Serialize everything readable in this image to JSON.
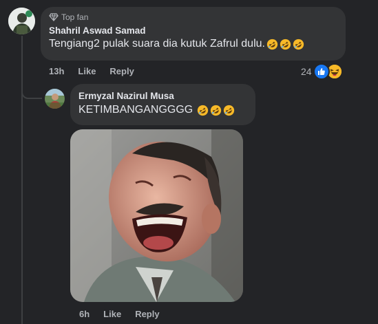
{
  "comment": {
    "badge_label": "Top fan",
    "author": "Shahril Aswad Samad",
    "text": "Tengiang2 pulak suara dia kutuk Zafrul dulu.",
    "emojis": [
      "rolling-on-floor-laughing",
      "rolling-on-floor-laughing",
      "rolling-on-floor-laughing"
    ],
    "time": "13h",
    "like_label": "Like",
    "reply_label": "Reply",
    "reaction_count": "24",
    "reaction_icons": [
      "like-icon",
      "haha-icon"
    ]
  },
  "reply": {
    "author": "Ermyzal Nazirul Musa",
    "text": "KETIMBANGANGGGG",
    "emojis": [
      "rolling-on-floor-laughing",
      "rolling-on-floor-laughing",
      "rolling-on-floor-laughing"
    ],
    "attachment": "laughing-man-gif",
    "time": "6h",
    "like_label": "Like",
    "reply_label": "Reply"
  },
  "colors": {
    "background": "#232427",
    "bubble": "#333436",
    "text_primary": "#e4e6eb",
    "text_secondary": "#b0b3b8",
    "like_blue": "#1877f2",
    "haha_yellow": "#f7b928"
  }
}
